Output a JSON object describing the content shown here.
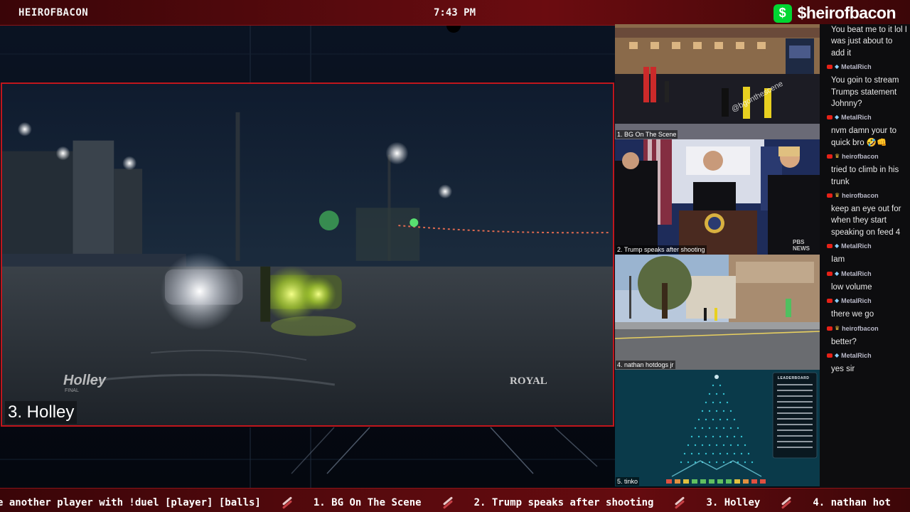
{
  "topbar": {
    "channel_name": "HEIROFBACON",
    "clock": "7:43 PM",
    "cashapp_symbol": "$",
    "cashapp_handle": "$heirofbacon"
  },
  "main_feed": {
    "caption": "3. Holley",
    "overlay_brand_left": "Holley",
    "overlay_brand_left_sub": "FINAL",
    "overlay_brand_right": "ROYAL"
  },
  "side_feeds": [
    {
      "caption": "1. BG On The Scene",
      "watermark": "@bgonthescene"
    },
    {
      "caption": "2. Trump speaks after shooting",
      "watermark": "PBS NEWS"
    },
    {
      "caption": "4. nathan hotdogs jr"
    },
    {
      "caption": "5. tinko",
      "panel_title": "LEADERBOARD"
    }
  ],
  "chat": [
    {
      "user": "",
      "badge": "",
      "text": "You beat me to it lol I was just about to add it"
    },
    {
      "user": "MetalRich",
      "badge": "diamond",
      "text": "You goin to stream Trumps statement Johnny?"
    },
    {
      "user": "MetalRich",
      "badge": "diamond",
      "text": "nvm damn your to quick bro 🤣👊"
    },
    {
      "user": "heirofbacon",
      "badge": "crown",
      "text": "tried to climb in his trunk"
    },
    {
      "user": "heirofbacon",
      "badge": "crown",
      "text": "keep an eye out for when they start speaking on feed 4"
    },
    {
      "user": "MetalRich",
      "badge": "diamond",
      "text": "Iam"
    },
    {
      "user": "MetalRich",
      "badge": "diamond",
      "text": "low volume"
    },
    {
      "user": "MetalRich",
      "badge": "diamond",
      "text": "there we go"
    },
    {
      "user": "heirofbacon",
      "badge": "crown",
      "text": "better?"
    },
    {
      "user": "MetalRich",
      "badge": "diamond",
      "text": "yes sir"
    }
  ],
  "ticker": [
    "e another player with !duel [player] [balls]",
    "1. BG On The Scene",
    "2. Trump speaks after shooting",
    "3. Holley",
    "4. nathan hot"
  ],
  "colors": {
    "accent_red": "#c0161c",
    "bar_red": "#5a0a0e",
    "cashapp_green": "#00d632",
    "chat_bg": "#0d0d0f"
  }
}
